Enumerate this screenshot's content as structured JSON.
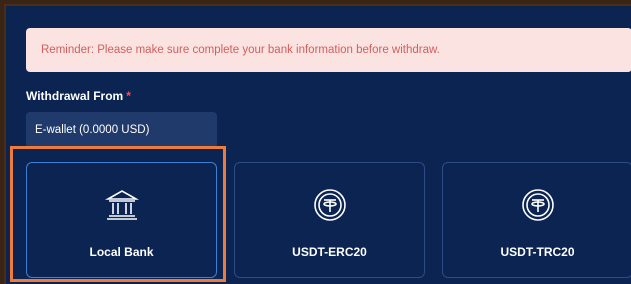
{
  "reminder": "Reminder: Please make sure complete your bank information before withdraw.",
  "withdraw_from": {
    "label": "Withdrawal From",
    "required_mark": "*",
    "value": "E-wallet (0.0000 USD)"
  },
  "methods": [
    {
      "label": "Local Bank",
      "icon": "bank-icon",
      "selected": true
    },
    {
      "label": "USDT-ERC20",
      "icon": "tether-icon",
      "selected": false
    },
    {
      "label": "USDT-TRC20",
      "icon": "tether-icon",
      "selected": false
    }
  ],
  "colors": {
    "panel_bg": "#0b2452",
    "reminder_bg": "#fbe3e2",
    "reminder_text": "#d0605d",
    "highlight": "#f07a3a"
  }
}
